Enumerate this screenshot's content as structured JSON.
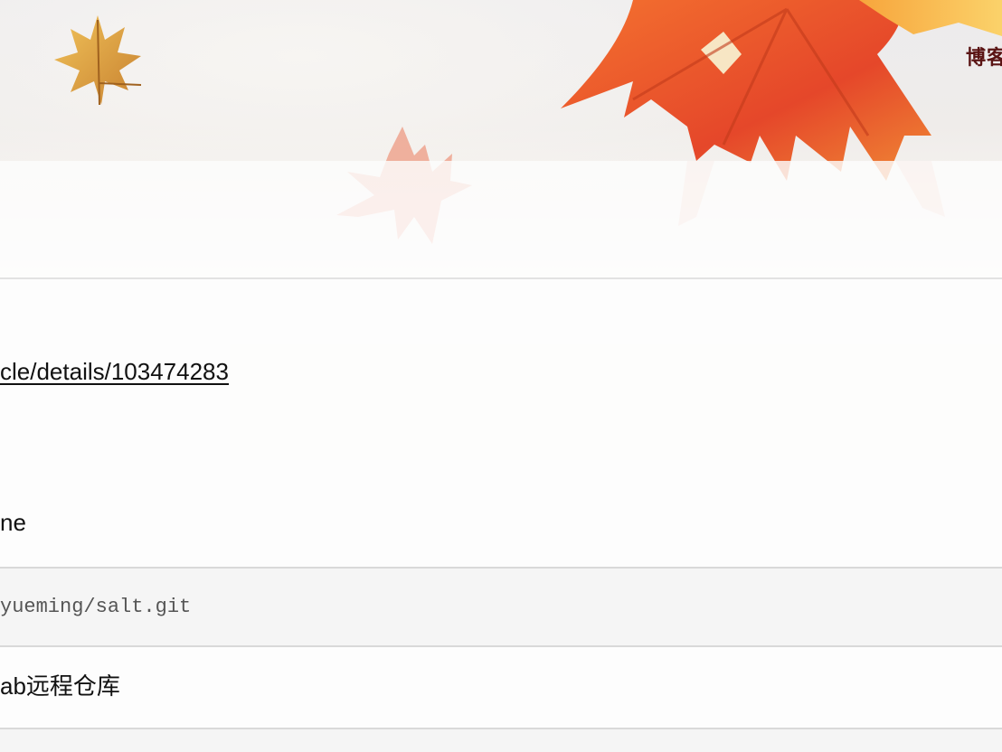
{
  "header": {
    "nav_label": "博客"
  },
  "article": {
    "link_text": "cle/details/103474283",
    "paragraph_1": "ne",
    "code_line": "yueming/salt.git",
    "paragraph_2": "ab远程仓库"
  },
  "colors": {
    "nav_text": "#5a1414",
    "code_background": "#f5f5f5",
    "leaf_red": "#e8522a",
    "leaf_orange": "#f39a3a",
    "leaf_gold": "#d9973b"
  }
}
